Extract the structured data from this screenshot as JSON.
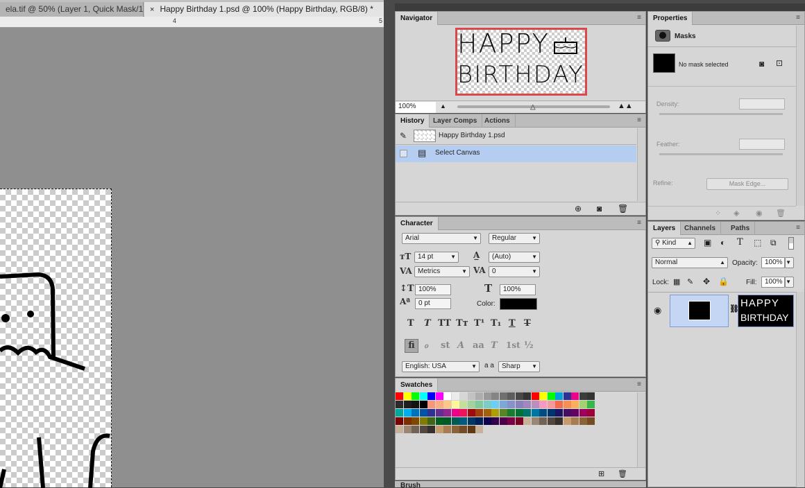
{
  "tabs": {
    "tab1": "ela.tif @ 50% (Layer 1, Quick Mask/1...",
    "tab2": "Happy Birthday 1.psd @ 100% (Happy Birthday, RGB/8) *",
    "close": "×"
  },
  "ruler": {
    "tick1": "4",
    "tick2": "5"
  },
  "navigator": {
    "title": "Navigator",
    "zoom": "100%"
  },
  "history": {
    "tabs": [
      "History",
      "Layer Comps",
      "Actions"
    ],
    "items": [
      "Happy Birthday 1.psd",
      "Select Canvas"
    ]
  },
  "character": {
    "title": "Character",
    "font_family": "Arial",
    "font_style": "Regular",
    "size": "14 pt",
    "leading": "(Auto)",
    "kerning": "Metrics",
    "tracking": "0",
    "vscale": "100%",
    "hscale": "100%",
    "baseline": "0 pt",
    "color_label": "Color:",
    "language": "English: USA",
    "aa_label": "a a",
    "antialias": "Sharp",
    "style_buttons": [
      "T",
      "T",
      "TT",
      "Tт",
      "T¹",
      "T₁",
      "T",
      "T"
    ],
    "ot_buttons": [
      "fi",
      "ℴ",
      "st",
      "A",
      "aa",
      "T",
      "1st",
      "½"
    ],
    "text_color": "#000000"
  },
  "swatches": {
    "title": "Swatches"
  },
  "brush": {
    "title": "Brush"
  },
  "properties": {
    "title": "Properties",
    "masks": "Masks",
    "no_mask": "No mask selected",
    "density": "Density:",
    "feather": "Feather:",
    "refine": "Refine:",
    "mask_edge": "Mask Edge..."
  },
  "layers": {
    "tabs": [
      "Layers",
      "Channels",
      "Paths"
    ],
    "kind": "Kind",
    "blend": "Normal",
    "opacity_label": "Opacity:",
    "opacity": "100%",
    "lock_label": "Lock:",
    "fill_label": "Fill:",
    "fill": "100%",
    "thumb_text": [
      "HAPPY",
      "BIRTHDAY"
    ]
  },
  "canvas_text": [
    "HAPPY",
    "BIRTHDAY"
  ]
}
